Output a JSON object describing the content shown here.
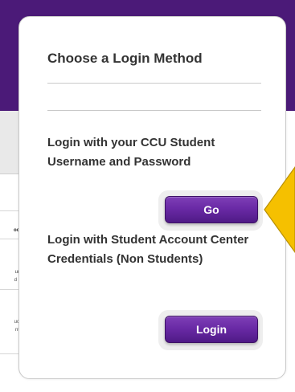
{
  "background": {
    "header_color": "#4b1a78",
    "snippets": [
      "oc",
      "ur",
      "d i",
      "uc",
      "nt"
    ]
  },
  "login_card": {
    "title": "Choose a Login Method",
    "options": [
      {
        "text": "Login with your CCU Student Username and Password",
        "button_label": "Go"
      },
      {
        "text": "Login with Student Account Center Credentials (Non Students)",
        "button_label": "Login"
      }
    ]
  },
  "callout": {
    "color": "#f5c000",
    "icon": "arrow-pointer-left"
  },
  "colors": {
    "button_purple": "#6a2aa6",
    "text": "#333333"
  }
}
